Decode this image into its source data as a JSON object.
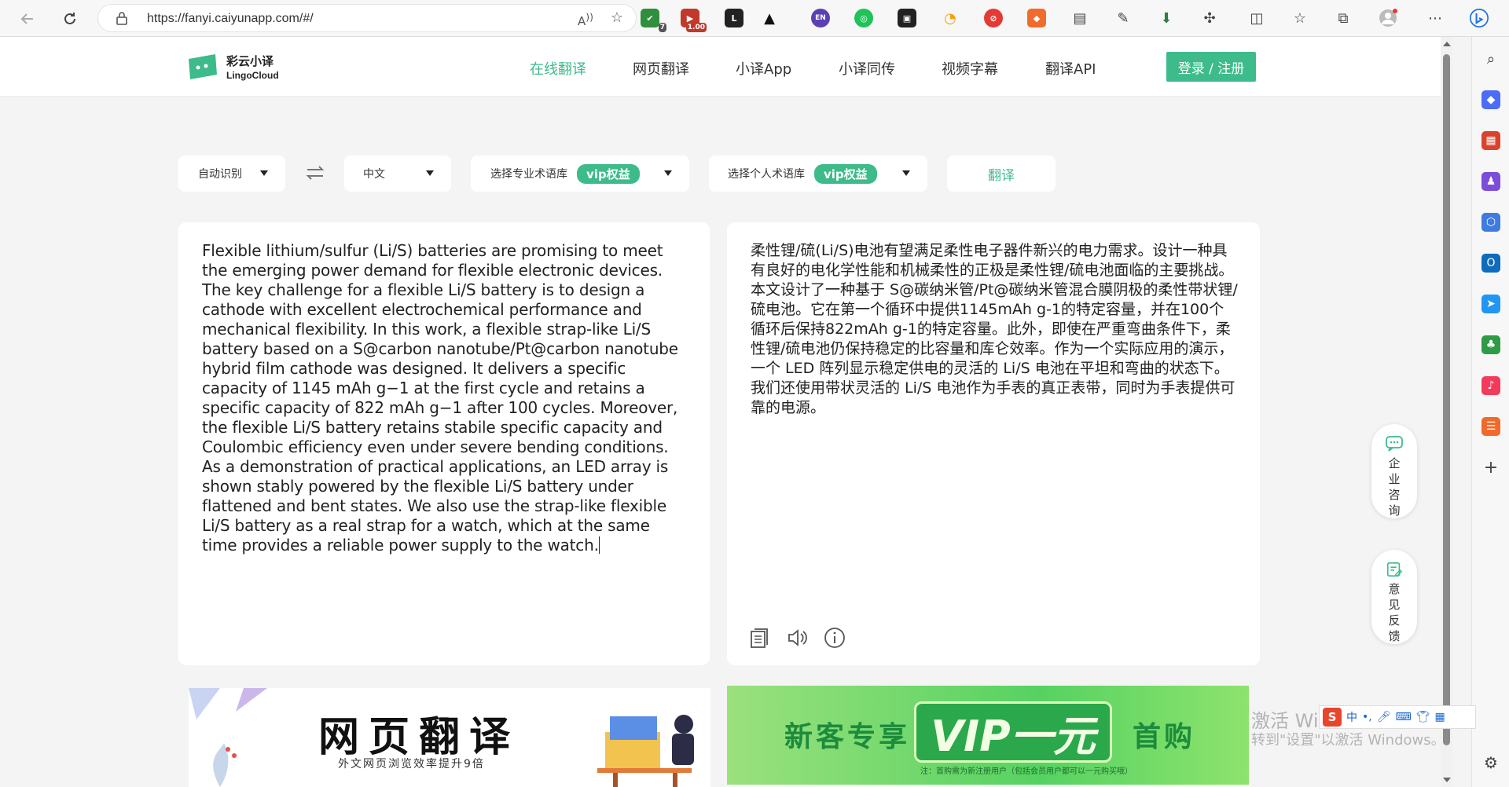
{
  "browser": {
    "url": "https://fanyi.caiyunapp.com/#/",
    "read_aloud_label": "A̅",
    "extensions": [
      {
        "name": "shield-extension",
        "color": "#2f8f3f",
        "badge": "7"
      },
      {
        "name": "video-extension",
        "color": "#c0392b",
        "badge": "1.00"
      },
      {
        "name": "l-extension",
        "color": "#222222",
        "badge": ""
      },
      {
        "name": "bird-extension",
        "color": "#111111",
        "badge": ""
      },
      {
        "name": "en-extension",
        "color": "#5b3fb3",
        "badge": ""
      },
      {
        "name": "green-circle-extension",
        "color": "#1fc35a",
        "badge": ""
      },
      {
        "name": "game-extension",
        "color": "#222222",
        "badge": ""
      },
      {
        "name": "orbit-extension",
        "color": "#f1c40f",
        "badge": ""
      },
      {
        "name": "block-extension",
        "color": "#e53935",
        "badge": ""
      },
      {
        "name": "brave-shield-extension",
        "color": "#ef6c2e",
        "badge": ""
      }
    ]
  },
  "header": {
    "logo_cn": "彩云小译",
    "logo_en": "LingoCloud",
    "nav": [
      "在线翻译",
      "网页翻译",
      "小译App",
      "小译同传",
      "视频字幕",
      "翻译API"
    ],
    "login": "登录 / 注册"
  },
  "toolbar": {
    "source_lang": "自动识别",
    "target_lang": "中文",
    "pro_glossary": "选择专业术语库",
    "personal_glossary": "选择个人术语库",
    "vip": "vip权益",
    "translate": "翻译"
  },
  "source": {
    "text": "Flexible lithium/sulfur (Li/S) batteries are promising to meet the emerging power demand for flexible electronic devices. The key challenge for a flexible Li/S battery is to design a cathode with excellent electrochemical performance and mechanical flexibility. In this work, a flexible strap-like Li/S battery based on a S@carbon nanotube/Pt@carbon nanotube hybrid film cathode was designed. It delivers a specific capacity of 1145 mAh g−1 at the first cycle and retains a specific capacity of 822 mAh g−1 after 100 cycles. Moreover, the flexible Li/S battery retains stabile specific capacity and Coulombic efficiency even under severe bending conditions. As a demonstration of practical applications, an LED array is shown stably powered by the flexible Li/S battery under flattened and bent states. We also use the strap-like flexible Li/S battery as a real strap for a watch, which at the same time provides a reliable power supply to the watch."
  },
  "target": {
    "text": "柔性锂/硫(Li/S)电池有望满足柔性电子器件新兴的电力需求。设计一种具有良好的电化学性能和机械柔性的正极是柔性锂/硫电池面临的主要挑战。本文设计了一种基于 S@碳纳米管/Pt@碳纳米管混合膜阴极的柔性带状锂/硫电池。它在第一个循环中提供1145mAh g-1的特定容量，并在100个循环后保持822mAh g-1的特定容量。此外，即使在严重弯曲条件下，柔性锂/硫电池仍保持稳定的比容量和库仑效率。作为一个实际应用的演示，一个 LED 阵列显示稳定供电的灵活的 Li/S 电池在平坦和弯曲的状态下。我们还使用带状灵活的 Li/S 电池作为手表的真正表带，同时为手表提供可靠的电源。"
  },
  "banners": {
    "web_title": "网页翻译",
    "web_sub": "外文网页浏览效率提升9倍",
    "vip_left": "新客专享",
    "vip_main": "VIP一元",
    "vip_right": "首购",
    "vip_note": "注：首购需为新注册用户（包括会员用户都可以一元购买哦）"
  },
  "float": {
    "consult": "企业咨询",
    "feedback": "意见反馈"
  },
  "system": {
    "watermark_1": "激活 Windows",
    "watermark_2": "转到\"设置\"以激活 Windows。",
    "ime_label": "中",
    "ime_s": "S"
  },
  "colors": {
    "brand": "#3dbb8a",
    "background": "#f4f4f5"
  }
}
